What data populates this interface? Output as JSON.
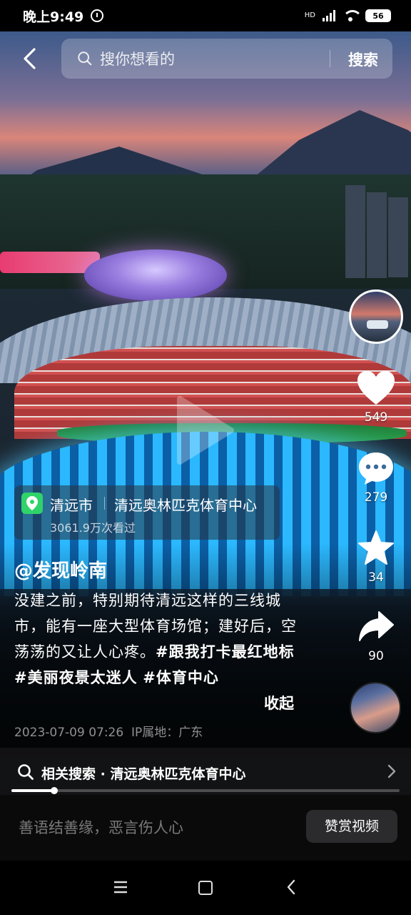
{
  "status": {
    "time": "晚上9:49",
    "hd": "HD",
    "battery": "56"
  },
  "search": {
    "placeholder": "搜你想看的",
    "button": "搜索"
  },
  "rail": {
    "likes": "549",
    "comments": "279",
    "favorites": "34",
    "shares": "90"
  },
  "location": {
    "city": "清远市",
    "place": "清远奥林匹克体育中心",
    "views": "3061.9万次看过"
  },
  "post": {
    "author": "@发现岭南",
    "caption_text": "没建之前，特别期待清远这样的三线城市，能有一座大型体育场馆；建好后，空荡荡的又让人心疼。",
    "tags": [
      "#跟我打卡最红地标",
      "#美丽夜景太迷人",
      "#体育中心"
    ],
    "collapse": "收起",
    "date": "2023-07-09 07:26",
    "ip": "IP属地：广东"
  },
  "related": {
    "text": "相关搜索 · 清远奥林匹克体育中心"
  },
  "progress": {
    "fraction": 0.11
  },
  "comment_bar": {
    "placeholder": "善语结善缘，恶言伤人心",
    "reward": "赞赏视频"
  },
  "colors": {
    "accent_green": "#2fd36a",
    "facade_blue": "#2bb8ff"
  }
}
